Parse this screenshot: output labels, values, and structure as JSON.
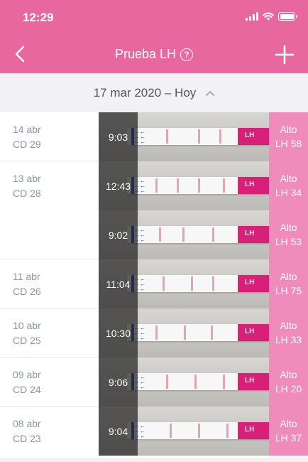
{
  "status_bar": {
    "time": "12:29"
  },
  "nav": {
    "title": "Prueba LH",
    "help_glyph": "?"
  },
  "date_range": {
    "label": "17 mar 2020 – Hoy"
  },
  "colors": {
    "header": "#e8679f",
    "result_overlay": "#ec78af",
    "strip_pink": "#d8207a",
    "strip_blue": "#1c37a8"
  },
  "days": [
    {
      "date": "14 abr",
      "cd": "CD 29",
      "entries": [
        {
          "time": "9:03",
          "result": "Alto",
          "lh": "LH 58"
        }
      ]
    },
    {
      "date": "13 abr",
      "cd": "CD 28",
      "entries": [
        {
          "time": "12:43",
          "result": "Alto",
          "lh": "LH 34"
        },
        {
          "time": "9:02",
          "result": "Alto",
          "lh": "LH 53"
        }
      ]
    },
    {
      "date": "11 abr",
      "cd": "CD 26",
      "entries": [
        {
          "time": "11:04",
          "result": "Alto",
          "lh": "LH 75"
        }
      ]
    },
    {
      "date": "10 abr",
      "cd": "CD 25",
      "entries": [
        {
          "time": "10:30",
          "result": "Alto",
          "lh": "LH 33"
        }
      ]
    },
    {
      "date": "09 abr",
      "cd": "CD 24",
      "entries": [
        {
          "time": "9:06",
          "result": "Alto",
          "lh": "LH 20"
        }
      ]
    },
    {
      "date": "08 abr",
      "cd": "CD 23",
      "entries": [
        {
          "time": "9:04",
          "result": "Alto",
          "lh": "LH 37"
        }
      ]
    }
  ],
  "icons": {
    "back": "chevron-left-icon",
    "add": "plus-icon",
    "help": "help-circle-icon",
    "collapse": "chevron-up-icon"
  }
}
